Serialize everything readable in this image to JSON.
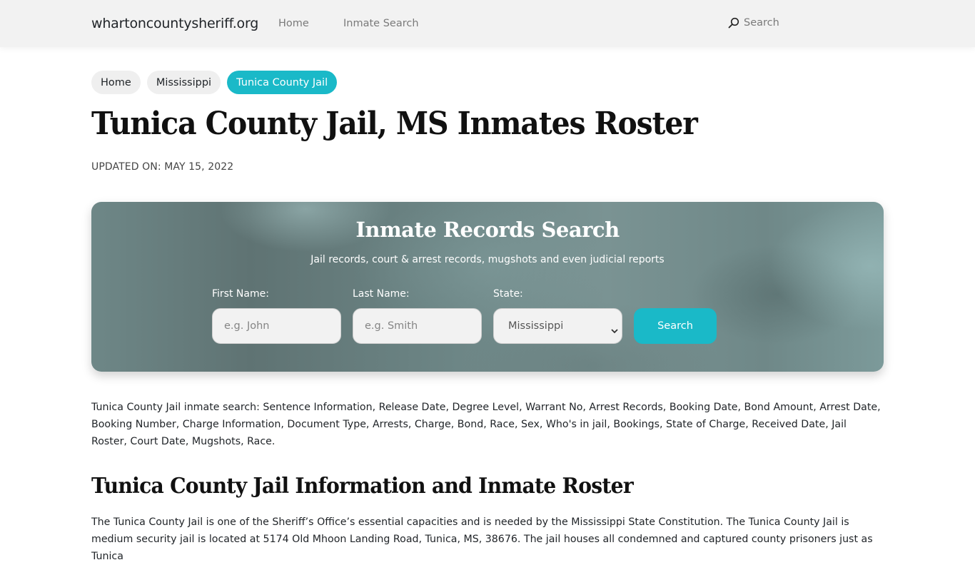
{
  "navbar": {
    "brand": "whartoncountysheriff.org",
    "links": [
      {
        "label": "Home"
      },
      {
        "label": "Inmate Search"
      }
    ],
    "search": {
      "icon": "search-icon",
      "label": "Search"
    }
  },
  "breadcrumbs": [
    {
      "label": "Home",
      "active": false
    },
    {
      "label": "Mississippi",
      "active": false
    },
    {
      "label": "Tunica County Jail",
      "active": true
    }
  ],
  "page": {
    "title": "Tunica County Jail, MS Inmates Roster",
    "updated": "UPDATED ON: MAY 15, 2022"
  },
  "search_banner": {
    "title": "Inmate Records Search",
    "subtitle": "Jail records, court & arrest records, mugshots and even judicial reports",
    "first_name": {
      "label": "First Name:",
      "placeholder": "e.g. John",
      "value": ""
    },
    "last_name": {
      "label": "Last Name:",
      "placeholder": "e.g. Smith",
      "value": ""
    },
    "state": {
      "label": "State:",
      "selected": "Mississippi"
    },
    "button_label": "Search"
  },
  "content": {
    "intro": "Tunica County Jail inmate search: Sentence Information, Release Date, Degree Level, Warrant No, Arrest Records, Booking Date, Bond Amount, Arrest Date, Booking Number, Charge Information, Document Type, Arrests, Charge, Bond, Race, Sex, Who's in jail, Bookings, State of Charge, Received Date, Jail Roster, Court Date, Mugshots, Race.",
    "section_title": "Tunica County Jail Information and Inmate Roster",
    "paragraph": "The Tunica County Jail is one of the Sheriff’s Office’s essential capacities and is needed by the Mississippi State Constitution. The Tunica County Jail is medium security jail is located at 5174 Old Mhoon Landing Road, Tunica, MS, 38676. The jail houses all condemned and captured county prisoners just as Tunica"
  },
  "colors": {
    "accent": "#1ab9c8",
    "navbar_bg": "#f2f2f2",
    "crumb_bg": "#efefef",
    "banner_base": "#6e8787"
  }
}
